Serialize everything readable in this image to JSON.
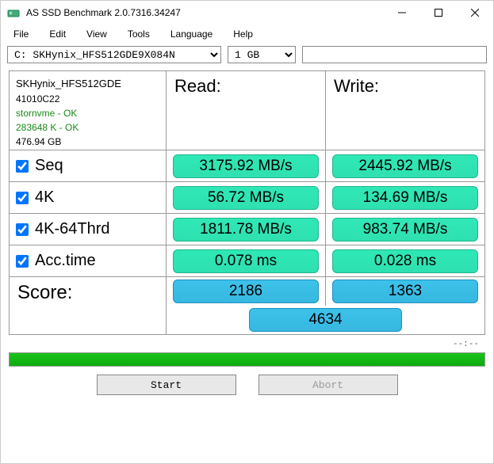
{
  "window": {
    "title": "AS SSD Benchmark 2.0.7316.34247"
  },
  "menu": {
    "file": "File",
    "edit": "Edit",
    "view": "View",
    "tools": "Tools",
    "language": "Language",
    "help": "Help"
  },
  "toolbar": {
    "drive": "C: SKHynix_HFS512GDE9X084N",
    "size": "1 GB",
    "search": ""
  },
  "info": {
    "model": "SKHynix_HFS512GDE",
    "firmware": "41010C22",
    "driver": "stornvme - OK",
    "align": "283648 K - OK",
    "capacity": "476.94 GB"
  },
  "headers": {
    "read": "Read:",
    "write": "Write:"
  },
  "rows": {
    "seq": {
      "label": "Seq",
      "read": "3175.92 MB/s",
      "write": "2445.92 MB/s"
    },
    "k4": {
      "label": "4K",
      "read": "56.72 MB/s",
      "write": "134.69 MB/s"
    },
    "k4thrd": {
      "label": "4K-64Thrd",
      "read": "1811.78 MB/s",
      "write": "983.74 MB/s"
    },
    "acc": {
      "label": "Acc.time",
      "read": "0.078 ms",
      "write": "0.028 ms"
    }
  },
  "score": {
    "label": "Score:",
    "read": "2186",
    "write": "1363",
    "total": "4634"
  },
  "status": "--:--",
  "buttons": {
    "start": "Start",
    "abort": "Abort"
  },
  "colors": {
    "green": "#2fe0b0",
    "blue": "#36b8e0",
    "progress": "#0faa0f"
  }
}
